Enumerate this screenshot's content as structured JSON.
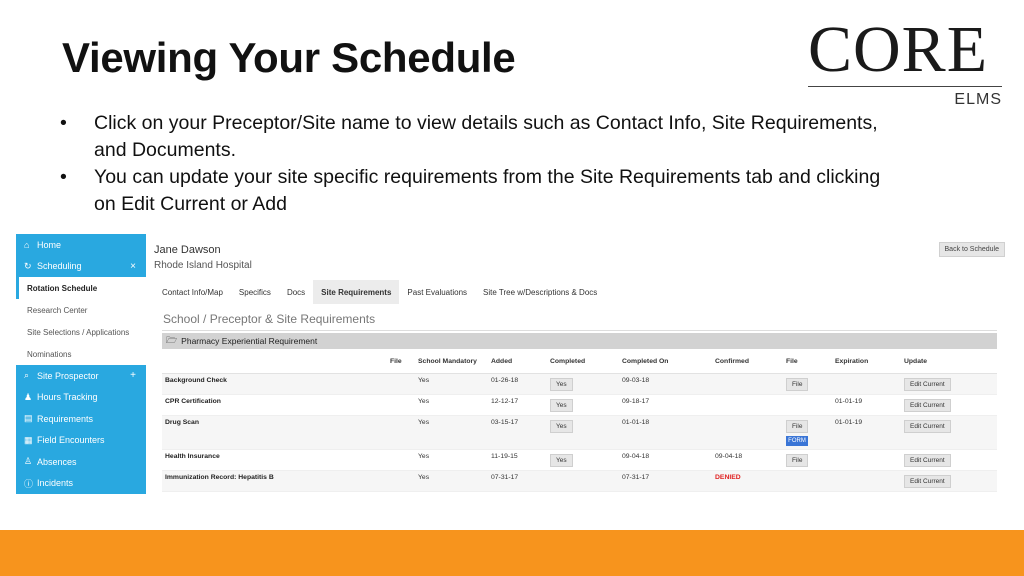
{
  "slide": {
    "title": "Viewing Your Schedule",
    "bullets": [
      "Click on your Preceptor/Site name to view details such as Contact Info, Site Requirements, and Documents.",
      "You can update your site specific requirements from the Site Requirements tab and clicking on Edit Current or Add"
    ],
    "accent_color": "#f7941d"
  },
  "logo": {
    "main": "CORE",
    "sub": "ELMS"
  },
  "sidebar": {
    "color": "#29a8e0",
    "items": [
      {
        "label": "Home",
        "icon": "home-icon",
        "glyph": "⌂",
        "style": "blue"
      },
      {
        "label": "Scheduling",
        "icon": "refresh-icon",
        "glyph": "↻",
        "style": "blue",
        "mark": "×"
      },
      {
        "label": "Rotation Schedule",
        "style": "sub-active"
      },
      {
        "label": "Research Center",
        "style": "sub"
      },
      {
        "label": "Site Selections / Applications",
        "style": "sub"
      },
      {
        "label": "Nominations",
        "style": "sub"
      },
      {
        "label": "Site Prospector",
        "icon": "search-icon",
        "glyph": "⌕",
        "style": "blue",
        "mark": "+"
      },
      {
        "label": "Hours Tracking",
        "icon": "users-icon",
        "glyph": "♟",
        "style": "blue"
      },
      {
        "label": "Requirements",
        "icon": "clipboard-icon",
        "glyph": "▤",
        "style": "blue"
      },
      {
        "label": "Field Encounters",
        "icon": "list-icon",
        "glyph": "▦",
        "style": "blue"
      },
      {
        "label": "Absences",
        "icon": "user-minus-icon",
        "glyph": "♙",
        "style": "blue"
      },
      {
        "label": "Incidents",
        "icon": "info-icon",
        "glyph": "ⓘ",
        "style": "blue"
      }
    ]
  },
  "header": {
    "name": "Jane Dawson",
    "site": "Rhode Island Hospital",
    "back_label": "Back to Schedule"
  },
  "tabs": [
    {
      "label": "Contact Info/Map",
      "active": false
    },
    {
      "label": "Specifics",
      "active": false
    },
    {
      "label": "Docs",
      "active": false
    },
    {
      "label": "Site Requirements",
      "active": true
    },
    {
      "label": "Past Evaluations",
      "active": false
    },
    {
      "label": "Site Tree w/Descriptions & Docs",
      "active": false
    }
  ],
  "panel": {
    "title": "School / Preceptor & Site Requirements",
    "section": "Pharmacy Experiential Requirement"
  },
  "table": {
    "columns": [
      "",
      "File",
      "School Mandatory",
      "Added",
      "Completed",
      "Completed On",
      "Confirmed",
      "File",
      "Expiration",
      "Update"
    ],
    "rows": [
      {
        "name": "Background Check",
        "mandatory": "Yes",
        "added": "01-26-18",
        "completed_btn": "Yes",
        "completed_on": "09-03-18",
        "confirmed": "",
        "file_btn": "File",
        "form_btn": "",
        "expiration": "",
        "update_btn": "Edit Current"
      },
      {
        "name": "CPR Certification",
        "mandatory": "Yes",
        "added": "12-12-17",
        "completed_btn": "Yes",
        "completed_on": "09-18-17",
        "confirmed": "",
        "file_btn": "",
        "form_btn": "",
        "expiration": "01-01-19",
        "update_btn": "Edit Current"
      },
      {
        "name": "Drug Scan",
        "mandatory": "Yes",
        "added": "03-15-17",
        "completed_btn": "Yes",
        "completed_on": "01-01-18",
        "confirmed": "",
        "file_btn": "File",
        "form_btn": "FORM",
        "expiration": "01-01-19",
        "update_btn": "Edit Current"
      },
      {
        "name": "Health Insurance",
        "mandatory": "Yes",
        "added": "11-19-15",
        "completed_btn": "Yes",
        "completed_on": "09-04-18",
        "confirmed": "09-04-18",
        "file_btn": "File",
        "form_btn": "",
        "expiration": "",
        "update_btn": "Edit Current"
      },
      {
        "name": "Immunization Record: Hepatitis B",
        "mandatory": "Yes",
        "added": "07-31-17",
        "completed_btn": "",
        "completed_on": "07-31-17",
        "confirmed": "DENIED",
        "file_btn": "",
        "form_btn": "",
        "expiration": "",
        "update_btn": "Edit Current"
      }
    ]
  }
}
